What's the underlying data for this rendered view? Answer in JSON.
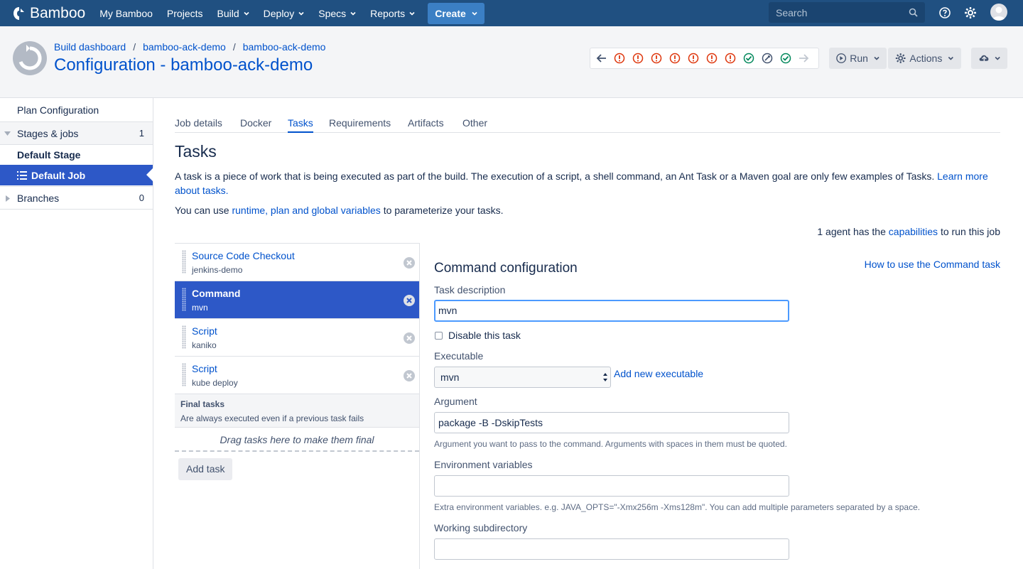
{
  "topnav": {
    "brand": "Bamboo",
    "items": [
      "My Bamboo",
      "Projects",
      "Build",
      "Deploy",
      "Specs",
      "Reports"
    ],
    "create_label": "Create",
    "search_placeholder": "Search"
  },
  "header": {
    "breadcrumbs": [
      "Build dashboard",
      "bamboo-ack-demo",
      "bamboo-ack-demo"
    ],
    "title": "Configuration - bamboo-ack-demo",
    "build_statuses": [
      "failed",
      "failed",
      "failed",
      "failed",
      "failed",
      "failed",
      "failed",
      "success",
      "manual",
      "success"
    ],
    "run_label": "Run",
    "actions_label": "Actions"
  },
  "sidebar": {
    "plan_configuration": "Plan Configuration",
    "stages_label": "Stages & jobs",
    "stages_count": "1",
    "default_stage": "Default Stage",
    "default_job": "Default Job",
    "branches_label": "Branches",
    "branches_count": "0"
  },
  "tabs": [
    "Job details",
    "Docker",
    "Tasks",
    "Requirements",
    "Artifacts",
    "Other"
  ],
  "main": {
    "heading": "Tasks",
    "desc": "A task is a piece of work that is being executed as part of the build. The execution of a script, a shell command, an Ant Task or a Maven goal are only few examples of Tasks.",
    "learn_more": "Learn more about tasks.",
    "vars_prefix": "You can use",
    "vars_link": "runtime, plan and global variables",
    "vars_suffix": "to parameterize your tasks.",
    "agents_prefix": "1 agent has the",
    "agents_link": "capabilities",
    "agents_suffix": "to run this job"
  },
  "tasks": [
    {
      "name": "Source Code Checkout",
      "sub": "jenkins-demo"
    },
    {
      "name": "Command",
      "sub": "mvn"
    },
    {
      "name": "Script",
      "sub": "kaniko"
    },
    {
      "name": "Script",
      "sub": "kube deploy"
    }
  ],
  "final_tasks": {
    "title": "Final tasks",
    "subtitle": "Are always executed even if a previous task fails",
    "drop_hint": "Drag tasks here to make them final"
  },
  "add_task_label": "Add task",
  "command_config": {
    "title": "Command configuration",
    "help_link": "How to use the Command task",
    "task_description_label": "Task description",
    "task_description_value": "mvn",
    "disable_label": "Disable this task",
    "executable_label": "Executable",
    "executable_value": "mvn",
    "add_executable": "Add new executable",
    "argument_label": "Argument",
    "argument_value": "package -B -DskipTests",
    "argument_hint": "Argument you want to pass to the command. Arguments with spaces in them must be quoted.",
    "env_label": "Environment variables",
    "env_value": "",
    "env_hint": "Extra environment variables. e.g. JAVA_OPTS=\"-Xmx256m -Xms128m\". You can add multiple parameters separated by a space.",
    "workdir_label": "Working subdirectory",
    "workdir_value": ""
  },
  "colors": {
    "nav": "#205081",
    "link": "#0052cc",
    "selected": "#2d58c7",
    "error": "#de350b",
    "success": "#00875a"
  }
}
